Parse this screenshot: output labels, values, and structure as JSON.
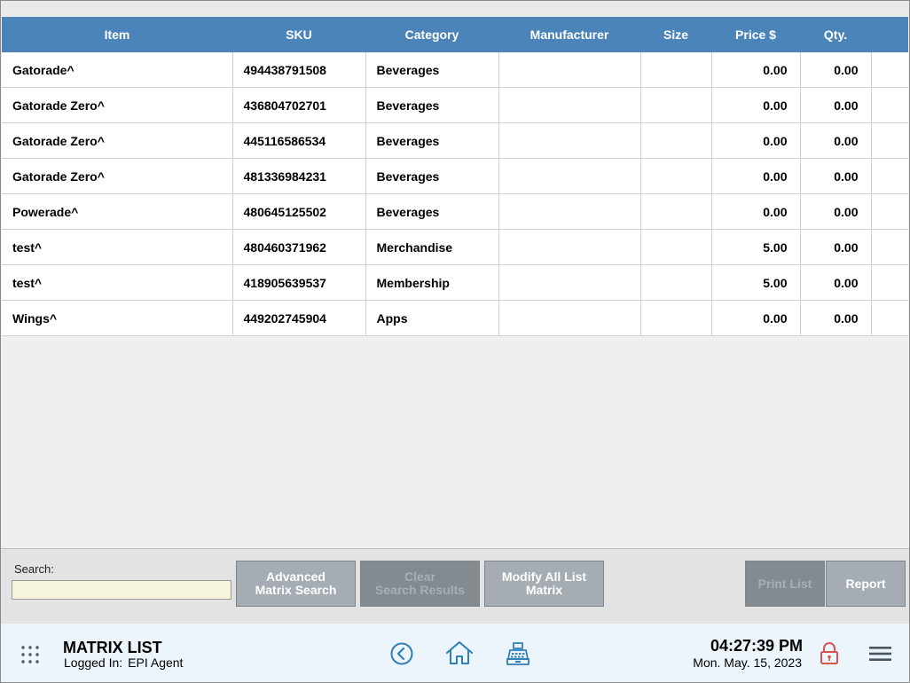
{
  "table": {
    "headers": [
      "Item",
      "SKU",
      "Category",
      "Manufacturer",
      "Size",
      "Price $",
      "Qty."
    ],
    "rows": [
      {
        "item": "Gatorade^",
        "sku": "494438791508",
        "category": "Beverages",
        "manufacturer": "",
        "size": "",
        "price": "0.00",
        "qty": "0.00"
      },
      {
        "item": "Gatorade Zero^",
        "sku": "436804702701",
        "category": "Beverages",
        "manufacturer": "",
        "size": "",
        "price": "0.00",
        "qty": "0.00"
      },
      {
        "item": "Gatorade Zero^",
        "sku": "445116586534",
        "category": "Beverages",
        "manufacturer": "",
        "size": "",
        "price": "0.00",
        "qty": "0.00"
      },
      {
        "item": "Gatorade Zero^",
        "sku": "481336984231",
        "category": "Beverages",
        "manufacturer": "",
        "size": "",
        "price": "0.00",
        "qty": "0.00"
      },
      {
        "item": "Powerade^",
        "sku": "480645125502",
        "category": "Beverages",
        "manufacturer": "",
        "size": "",
        "price": "0.00",
        "qty": "0.00"
      },
      {
        "item": "test^",
        "sku": "480460371962",
        "category": "Merchandise",
        "manufacturer": "",
        "size": "",
        "price": "5.00",
        "qty": "0.00"
      },
      {
        "item": "test^",
        "sku": "418905639537",
        "category": "Membership",
        "manufacturer": "",
        "size": "",
        "price": "5.00",
        "qty": "0.00"
      },
      {
        "item": "Wings^",
        "sku": "449202745904",
        "category": "Apps",
        "manufacturer": "",
        "size": "",
        "price": "0.00",
        "qty": "0.00"
      }
    ]
  },
  "search": {
    "label": "Search:",
    "value": "",
    "placeholder": ""
  },
  "buttons": {
    "advanced_search": {
      "line1": "Advanced",
      "line2": "Matrix Search"
    },
    "clear_results": {
      "line1": "Clear",
      "line2": "Search Results"
    },
    "modify_all": {
      "line1": "Modify All List",
      "line2": "Matrix"
    },
    "print_list": "Print List",
    "report": "Report"
  },
  "footer": {
    "title": "MATRIX LIST",
    "logged_in_label": "Logged In:",
    "user": "EPI Agent",
    "time": "04:27:39 PM",
    "date": "Mon. May. 15, 2023"
  },
  "icons": {
    "apps": "grid-dots-icon",
    "back": "chevron-left-circle-icon",
    "home": "home-icon",
    "register": "cash-register-icon",
    "lock": "lock-icon",
    "menu": "hamburger-menu-icon"
  },
  "colors": {
    "header_blue": "#4a84b9",
    "icon_blue": "#2f7fb8",
    "lock_red": "#d9534f",
    "search_bg": "#f6f4dc"
  }
}
